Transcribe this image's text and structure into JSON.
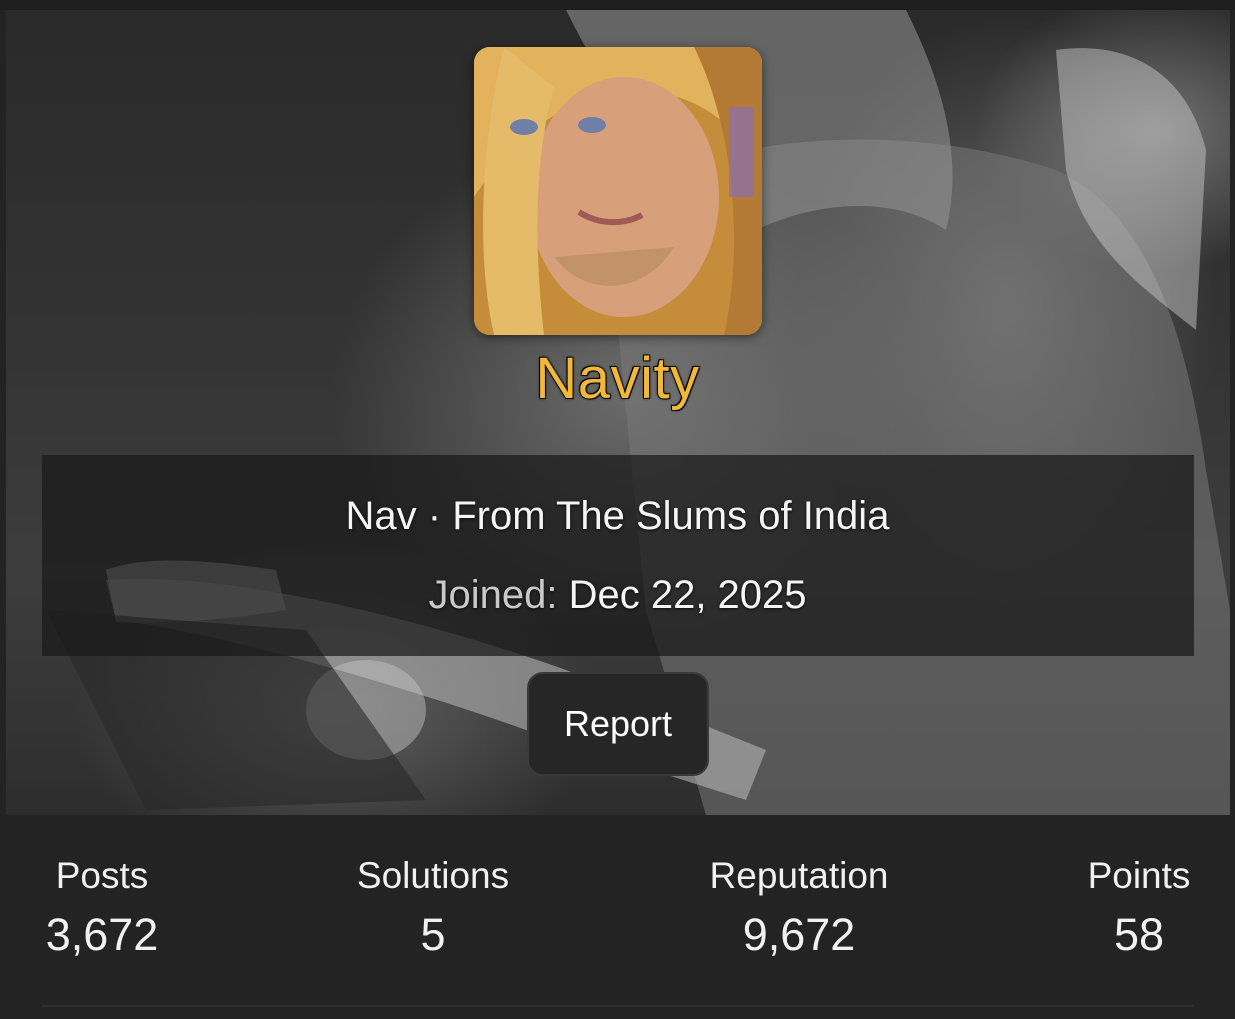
{
  "profile": {
    "username": "Navity",
    "tagline": "Nav · From The Slums of India",
    "joined_label": "Joined:",
    "joined_value": "Dec 22, 2025",
    "report_label": "Report",
    "username_color": "#f2b83c"
  },
  "stats": [
    {
      "label": "Posts",
      "value": "3,672"
    },
    {
      "label": "Solutions",
      "value": "5"
    },
    {
      "label": "Reputation",
      "value": "9,672"
    },
    {
      "label": "Points",
      "value": "58"
    }
  ]
}
